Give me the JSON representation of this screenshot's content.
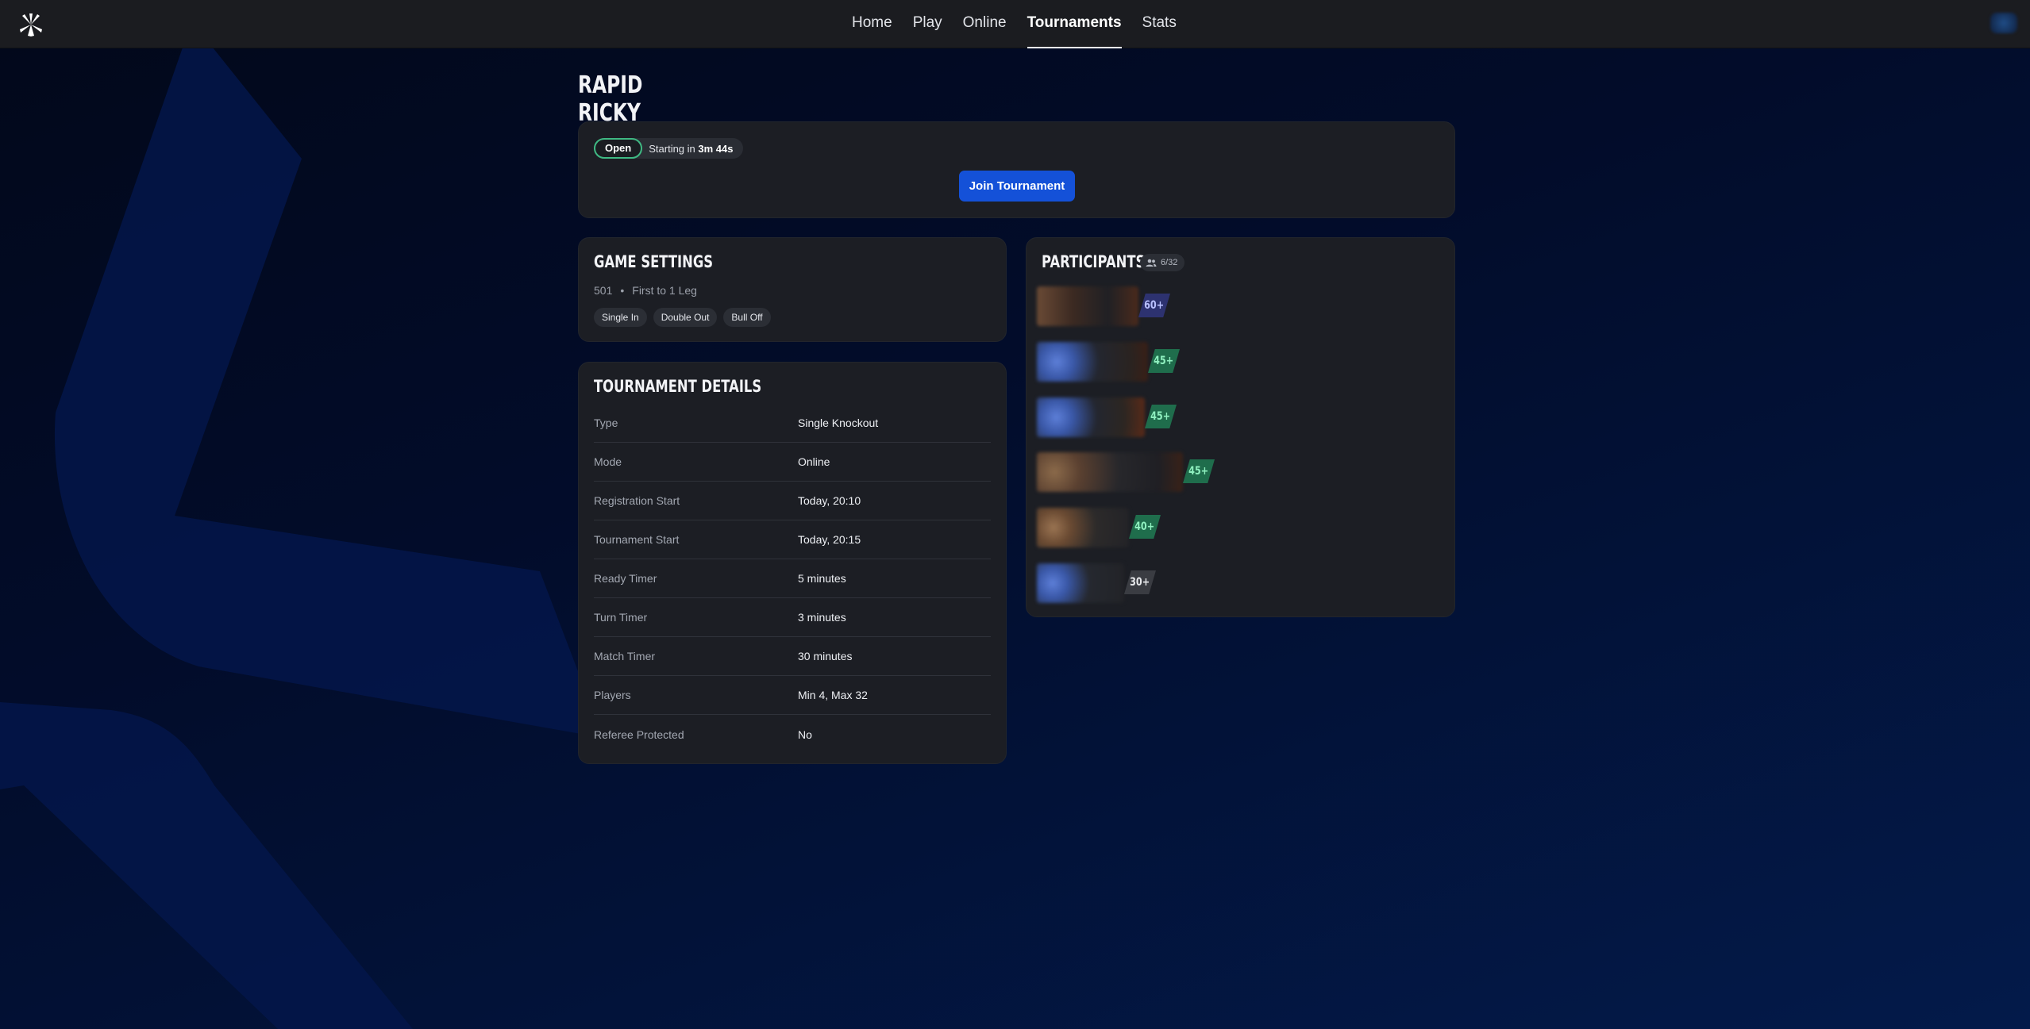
{
  "nav": {
    "items": [
      {
        "label": "Home",
        "active": false
      },
      {
        "label": "Play",
        "active": false
      },
      {
        "label": "Online",
        "active": false
      },
      {
        "label": "Tournaments",
        "active": true
      },
      {
        "label": "Stats",
        "active": false
      }
    ]
  },
  "tournament": {
    "title": "RAPID RICKY",
    "status": "Open",
    "starting_prefix": "Starting in",
    "starting_time": "3m 44s",
    "join_label": "Join Tournament"
  },
  "game_settings": {
    "title": "GAME SETTINGS",
    "game": "501",
    "format": "First to 1 Leg",
    "chips": [
      "Single In",
      "Double Out",
      "Bull Off"
    ]
  },
  "details": {
    "title": "TOURNAMENT DETAILS",
    "rows": [
      {
        "label": "Type",
        "value": "Single Knockout"
      },
      {
        "label": "Mode",
        "value": "Online"
      },
      {
        "label": "Registration Start",
        "value": "Today, 20:10"
      },
      {
        "label": "Tournament Start",
        "value": "Today, 20:15"
      },
      {
        "label": "Ready Timer",
        "value": "5 minutes"
      },
      {
        "label": "Turn Timer",
        "value": "3 minutes"
      },
      {
        "label": "Match Timer",
        "value": "30 minutes"
      },
      {
        "label": "Players",
        "value": "Min 4, Max 32"
      },
      {
        "label": "Referee Protected",
        "value": "No"
      }
    ]
  },
  "participants": {
    "title": "PARTICIPANTS",
    "count": "6/32",
    "list": [
      {
        "level": "60+"
      },
      {
        "level": "45+"
      },
      {
        "level": "45+"
      },
      {
        "level": "45+"
      },
      {
        "level": "40+"
      },
      {
        "level": "30+"
      }
    ]
  },
  "colors": {
    "accent": "#1451d8",
    "open_badge": "#3fb983",
    "card_bg": "#1c1e24",
    "topbar_bg": "#1b1c20"
  }
}
